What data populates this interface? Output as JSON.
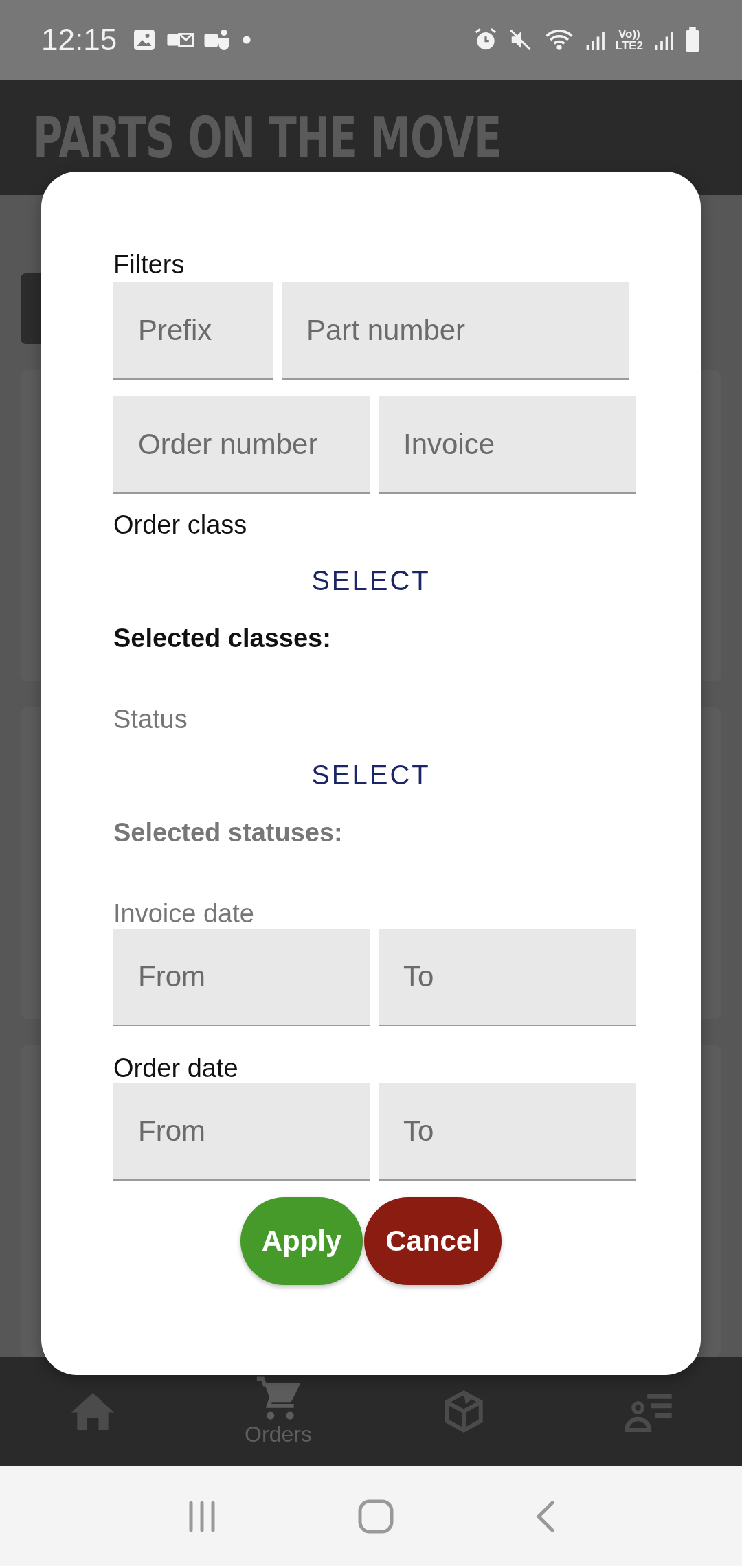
{
  "status_bar": {
    "time": "12:15",
    "network_top": "Vo))",
    "network_bottom": "LTE2"
  },
  "header": {
    "title": "PARTS ON THE MOVE"
  },
  "dialog": {
    "title": "Filters",
    "field_rows": [
      [
        {
          "placeholder": "Prefix"
        },
        {
          "placeholder": "Part number"
        }
      ],
      [
        {
          "placeholder": "Order number"
        },
        {
          "placeholder": "Invoice"
        }
      ]
    ],
    "sections": [
      {
        "kind": "select",
        "label": "Order class",
        "button": "SELECT",
        "selected_label": "Selected classes:",
        "disabled": false
      },
      {
        "kind": "select",
        "label": "Status",
        "button": "SELECT",
        "selected_label": "Selected statuses:",
        "disabled": true
      },
      {
        "kind": "dates",
        "label": "Invoice date",
        "disabled": true,
        "fields": [
          {
            "placeholder": "From"
          },
          {
            "placeholder": "To"
          }
        ]
      },
      {
        "kind": "dates",
        "label": "Order date",
        "disabled": false,
        "fields": [
          {
            "placeholder": "From"
          },
          {
            "placeholder": "To"
          }
        ]
      }
    ],
    "buttons": [
      {
        "label": "Apply",
        "kind": "apply"
      },
      {
        "label": "Cancel",
        "kind": "cancel"
      }
    ]
  },
  "bottom_nav": [
    {
      "selected": false
    },
    {
      "label": "Orders",
      "selected": true
    },
    {
      "selected": false
    },
    {
      "selected": false
    }
  ]
}
